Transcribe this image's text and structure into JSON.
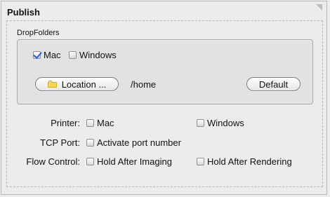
{
  "panel": {
    "title": "Publish"
  },
  "dropfolders": {
    "title": "DropFolders",
    "mac_label": "Mac",
    "windows_label": "Windows",
    "location_label": "Location ...",
    "path_value": "/home",
    "default_label": "Default"
  },
  "printer": {
    "label": "Printer:",
    "mac_label": "Mac",
    "windows_label": "Windows"
  },
  "tcp_port": {
    "label": "TCP Port:",
    "activate_label": "Activate port number"
  },
  "flow_control": {
    "label": "Flow Control:",
    "hold_after_imaging_label": "Hold After Imaging",
    "hold_after_rendering_label": "Hold After Rendering"
  },
  "icons": {
    "location_button_icon": "folder-icon",
    "header_corner_icon": "collapse-corner-icon"
  },
  "colors": {
    "background": "#ececec",
    "group_background": "#e2e2e2",
    "check_accent": "#2b5fd6",
    "folder_icon": "#f4d74f"
  }
}
